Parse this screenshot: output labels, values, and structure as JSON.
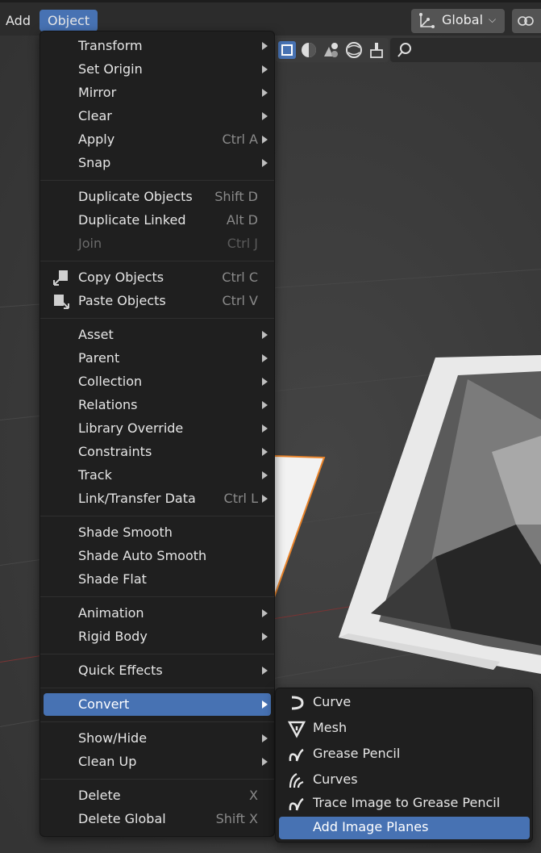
{
  "topbar": {
    "add_label": "Add",
    "object_label": "Object",
    "orientation_label": "Global",
    "orientation_icon": "transform-orientation-icon",
    "snap_icon": "link-icon"
  },
  "colors": {
    "accent": "#4772b3",
    "menu_bg": "#1f1f1f",
    "selection_outline": "#e8832a",
    "x_axis": "#7a3434"
  },
  "object_menu": {
    "groups": [
      [
        {
          "label": "Transform",
          "shortcut": "",
          "submenu": true
        },
        {
          "label": "Set Origin",
          "shortcut": "",
          "submenu": true
        },
        {
          "label": "Mirror",
          "shortcut": "",
          "submenu": true
        },
        {
          "label": "Clear",
          "shortcut": "",
          "submenu": true
        },
        {
          "label": "Apply",
          "shortcut": "Ctrl A",
          "submenu": true
        },
        {
          "label": "Snap",
          "shortcut": "",
          "submenu": true
        }
      ],
      [
        {
          "label": "Duplicate Objects",
          "shortcut": "Shift D"
        },
        {
          "label": "Duplicate Linked",
          "shortcut": "Alt D"
        },
        {
          "label": "Join",
          "shortcut": "Ctrl J",
          "disabled": true
        }
      ],
      [
        {
          "label": "Copy Objects",
          "shortcut": "Ctrl C",
          "icon": "copy-icon"
        },
        {
          "label": "Paste Objects",
          "shortcut": "Ctrl V",
          "icon": "paste-icon"
        }
      ],
      [
        {
          "label": "Asset",
          "shortcut": "",
          "submenu": true
        },
        {
          "label": "Parent",
          "shortcut": "",
          "submenu": true
        },
        {
          "label": "Collection",
          "shortcut": "",
          "submenu": true
        },
        {
          "label": "Relations",
          "shortcut": "",
          "submenu": true
        },
        {
          "label": "Library Override",
          "shortcut": "",
          "submenu": true
        },
        {
          "label": "Constraints",
          "shortcut": "",
          "submenu": true
        },
        {
          "label": "Track",
          "shortcut": "",
          "submenu": true
        },
        {
          "label": "Link/Transfer Data",
          "shortcut": "Ctrl L",
          "submenu": true
        }
      ],
      [
        {
          "label": "Shade Smooth",
          "shortcut": ""
        },
        {
          "label": "Shade Auto Smooth",
          "shortcut": ""
        },
        {
          "label": "Shade Flat",
          "shortcut": ""
        }
      ],
      [
        {
          "label": "Animation",
          "shortcut": "",
          "submenu": true
        },
        {
          "label": "Rigid Body",
          "shortcut": "",
          "submenu": true
        }
      ],
      [
        {
          "label": "Quick Effects",
          "shortcut": "",
          "submenu": true
        }
      ],
      [
        {
          "label": "Convert",
          "shortcut": "",
          "submenu": true,
          "active": true
        }
      ],
      [
        {
          "label": "Show/Hide",
          "shortcut": "",
          "submenu": true
        },
        {
          "label": "Clean Up",
          "shortcut": "",
          "submenu": true
        }
      ],
      [
        {
          "label": "Delete",
          "shortcut": "X"
        },
        {
          "label": "Delete Global",
          "shortcut": "Shift X"
        }
      ]
    ]
  },
  "convert_submenu": {
    "items": [
      {
        "label": "Curve",
        "icon": "curve-icon"
      },
      {
        "label": "Mesh",
        "icon": "mesh-icon"
      },
      {
        "label": "Grease Pencil",
        "icon": "grease-pencil-icon"
      },
      {
        "label": "Curves",
        "icon": "curves-icon"
      },
      {
        "label": "Trace Image to Grease Pencil",
        "icon": "grease-pencil-icon"
      },
      {
        "label": "Add Image Planes",
        "icon": "",
        "active": true
      }
    ]
  }
}
